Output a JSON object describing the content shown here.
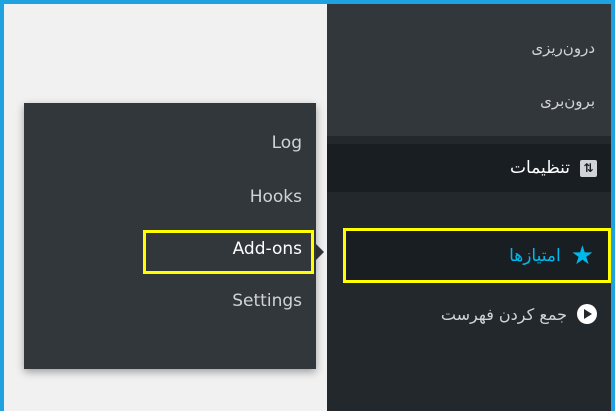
{
  "colors": {
    "frame": "#1fa2e0",
    "sidebar_bg": "#23282d",
    "submenu_bg": "#32373c",
    "active_bg": "#191e23",
    "accent": "#00b9eb",
    "highlight": "#ffff00"
  },
  "sidebar": {
    "submenu": {
      "import_label": "درون‌ریزی",
      "export_label": "برون‌بری"
    },
    "items": [
      {
        "label": "تنظیمات",
        "icon": "sliders-icon"
      },
      {
        "label": "امتیازها",
        "icon": "star-icon"
      },
      {
        "label": "جمع کردن فهرست",
        "icon": "collapse-icon"
      }
    ]
  },
  "flyout": {
    "items": [
      {
        "label": "Log"
      },
      {
        "label": "Hooks"
      },
      {
        "label": "Add-ons"
      },
      {
        "label": "Settings"
      }
    ]
  }
}
